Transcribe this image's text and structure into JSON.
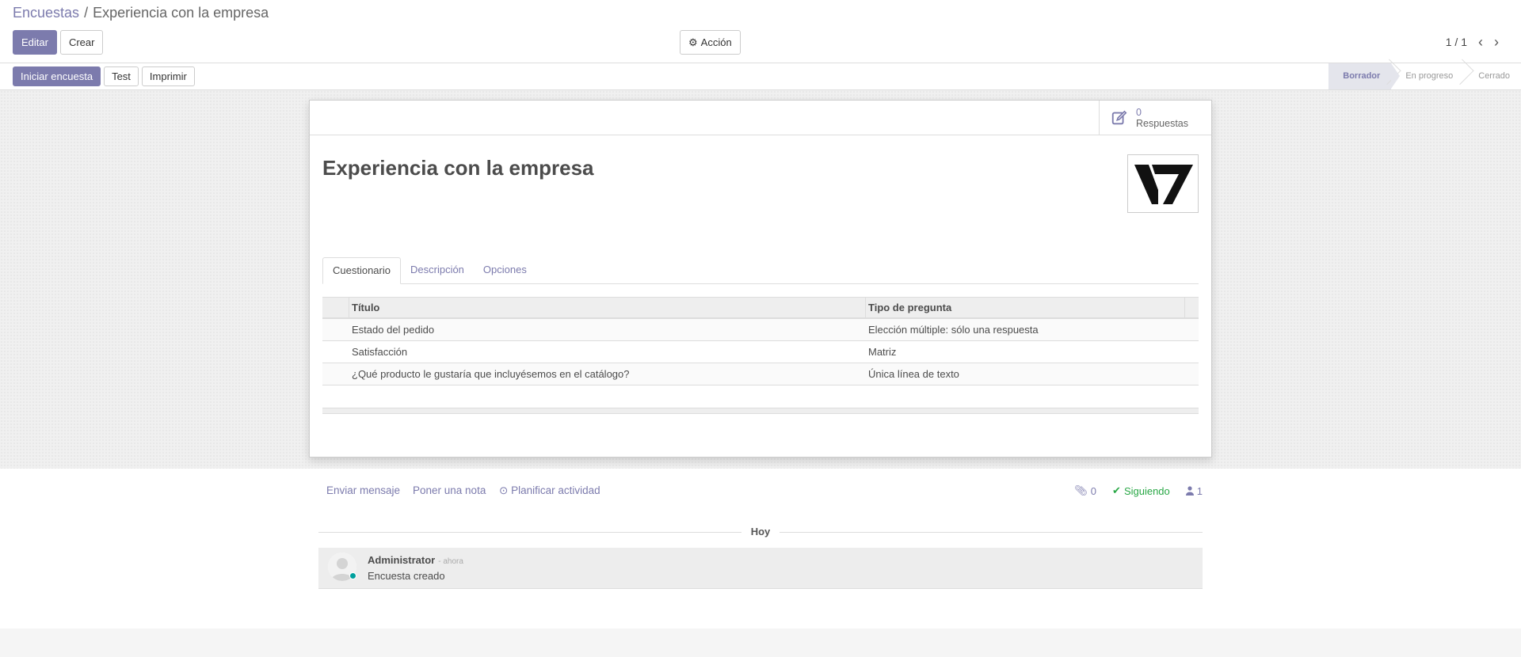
{
  "breadcrumb": {
    "parent": "Encuestas",
    "separator": "/",
    "current": "Experiencia con la empresa"
  },
  "toolbar": {
    "edit_label": "Editar",
    "create_label": "Crear",
    "action_label": "Acción",
    "action_icon": "gear-icon"
  },
  "pager": {
    "value": "1 / 1"
  },
  "statusbar": {
    "buttons": {
      "start": "Iniciar encuesta",
      "test": "Test",
      "print": "Imprimir"
    },
    "stages": [
      "Borrador",
      "En progreso",
      "Cerrado"
    ],
    "active_stage": "Borrador"
  },
  "sheet": {
    "stat": {
      "value": "0",
      "label": "Respuestas",
      "icon": "edit-icon"
    },
    "title": "Experiencia con la empresa",
    "tabs": [
      "Cuestionario",
      "Descripción",
      "Opciones"
    ],
    "table": {
      "headers": {
        "title": "Título",
        "type": "Tipo de pregunta"
      },
      "rows": [
        {
          "title": "Estado del pedido",
          "type": "Elección múltiple: sólo una respuesta"
        },
        {
          "title": "Satisfacción",
          "type": "Matriz"
        },
        {
          "title": "¿Qué producto le gustaría que incluyésemos en el catálogo?",
          "type": "Única línea de texto"
        }
      ]
    }
  },
  "chatter": {
    "send_message": "Enviar mensaje",
    "log_note": "Poner una nota",
    "schedule_activity": "Planificar actividad",
    "attachments_count": "0",
    "following_label": "Siguiendo",
    "followers_count": "1",
    "date_separator": "Hoy",
    "message": {
      "author": "Administrator",
      "date": "- ahora",
      "body": "Encuesta creado"
    }
  },
  "colors": {
    "brand": "#7c7bad",
    "following": "#28a745",
    "online": "#00a09d"
  }
}
